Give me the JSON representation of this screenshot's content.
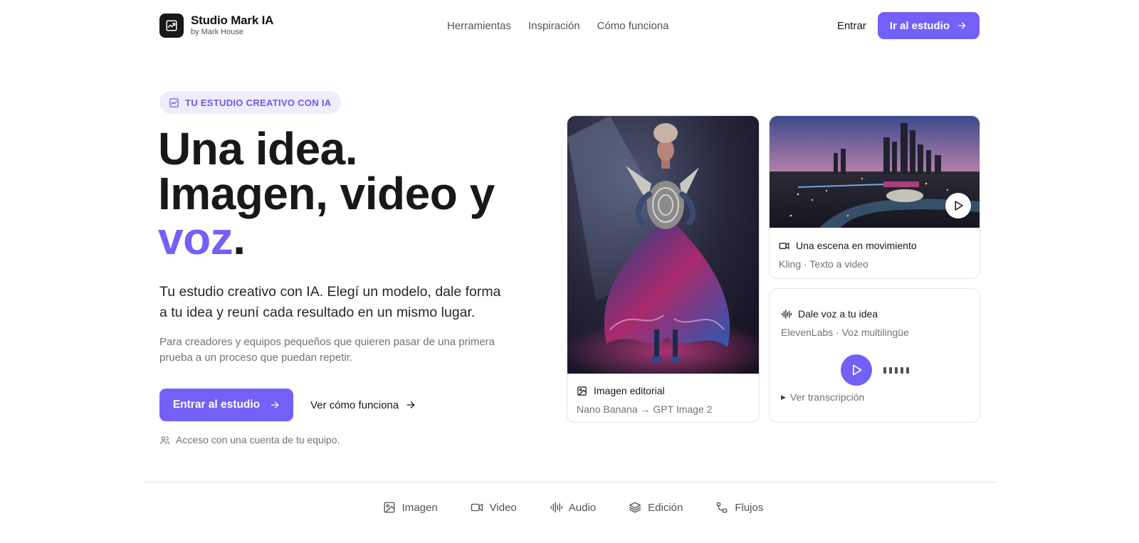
{
  "brand": {
    "name": "Studio Mark IA",
    "subtitle": "by Mark House",
    "logo_icon": "chart-image-icon"
  },
  "nav": {
    "links": [
      "Herramientas",
      "Inspiración",
      "Cómo funciona"
    ],
    "login": "Entrar",
    "cta": "Ir al estudio"
  },
  "hero": {
    "eyebrow": "TU ESTUDIO CREATIVO CON IA",
    "headline_line1": "Una idea.",
    "headline_line2": "Imagen, video y",
    "headline_accent": "voz",
    "headline_period": ".",
    "lead": "Tu estudio creativo con IA. Elegí un modelo, dale forma a tu idea y reuní cada resultado en un mismo lugar.",
    "sub": "Para creadores y equipos pequeños que quieren pasar de una primera prueba a un proceso que puedan repetir.",
    "cta_primary": "Entrar al estudio",
    "cta_secondary": "Ver cómo funciona",
    "access_note": "Acceso con una cuenta de tu equipo."
  },
  "cards": {
    "editorial": {
      "title": "Imagen editorial",
      "meta": "Nano Banana → GPT Image 2",
      "icon": "image-icon"
    },
    "scene": {
      "title": "Una escena en movimiento",
      "meta": "Kling · Texto a video",
      "icon": "video-icon"
    },
    "voice": {
      "title": "Dale voz a tu idea",
      "meta": "ElevenLabs · Voz multilingüe",
      "icon": "waveform-icon",
      "transcript": "Ver transcripción"
    }
  },
  "tabs": [
    {
      "label": "Imagen",
      "icon": "image-icon"
    },
    {
      "label": "Video",
      "icon": "video-icon"
    },
    {
      "label": "Audio",
      "icon": "waveform-icon"
    },
    {
      "label": "Edición",
      "icon": "layers-icon"
    },
    {
      "label": "Flujos",
      "icon": "flow-icon"
    }
  ],
  "colors": {
    "accent": "#7360f6",
    "accent_soft": "#efedfc",
    "text": "#18181b",
    "muted": "#71717a"
  }
}
